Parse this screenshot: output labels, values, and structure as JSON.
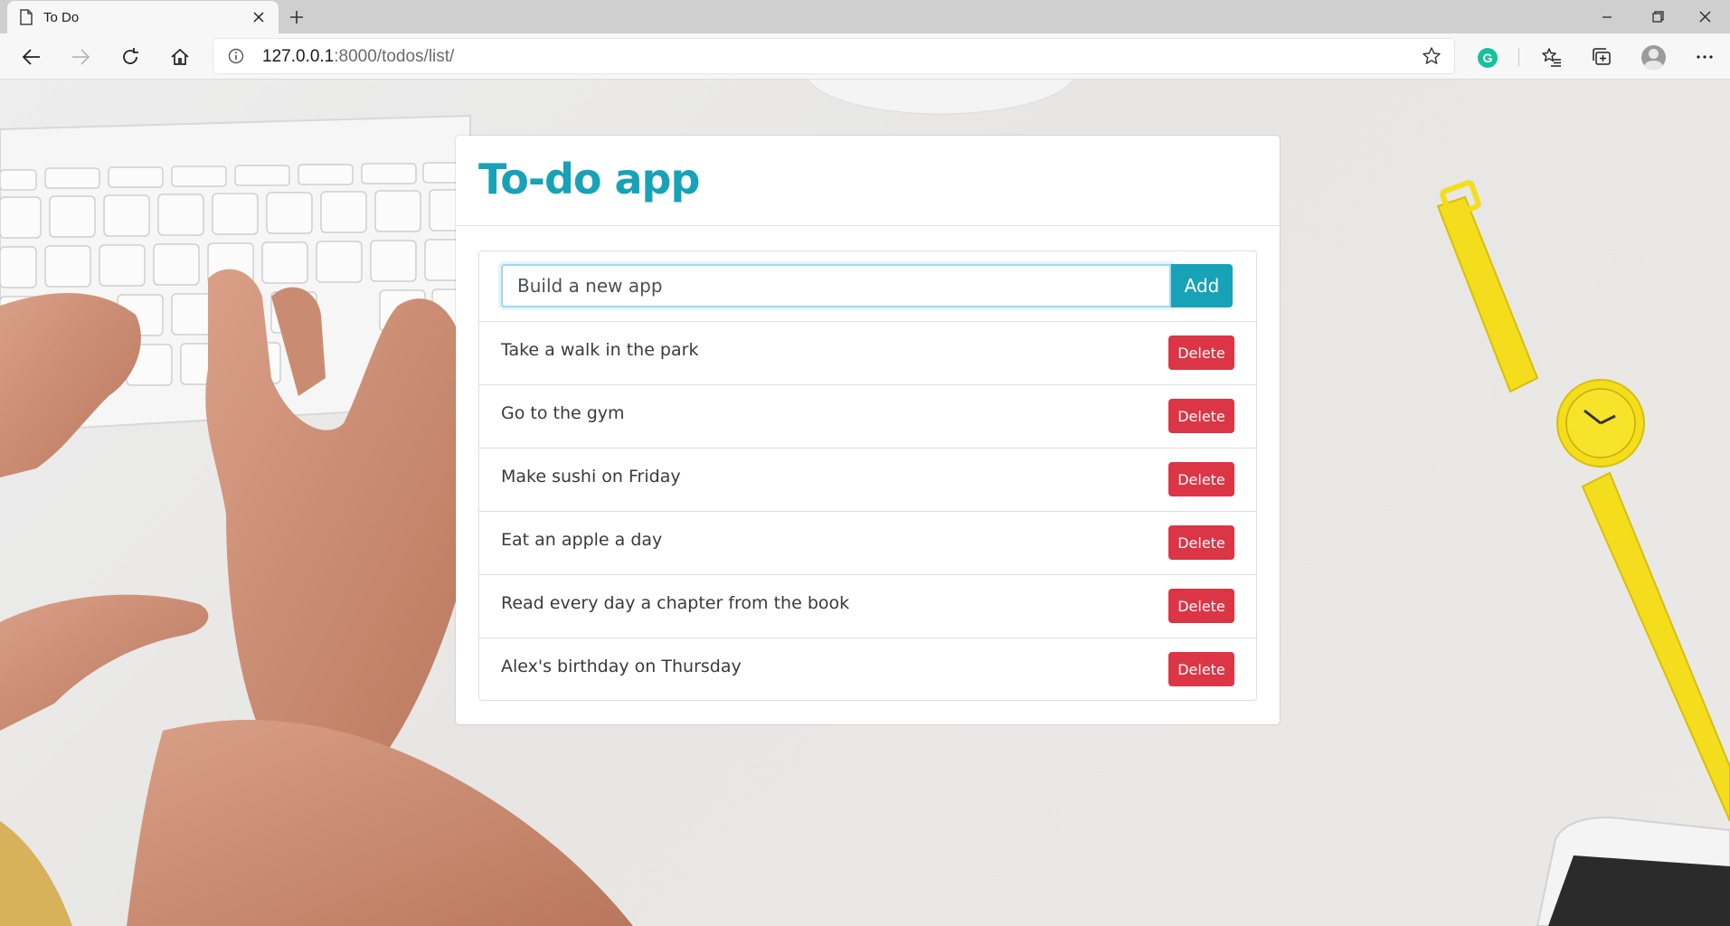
{
  "browser": {
    "tab_title": "To Do",
    "url_host": "127.0.0.1",
    "url_rest": ":8000/todos/list/"
  },
  "app": {
    "title": "To-do app",
    "input_value": "Build a new app",
    "add_label": "Add",
    "delete_label": "Delete",
    "accent_color": "#17a2b8",
    "danger_color": "#dc3545",
    "todos": [
      "Take a walk in the park",
      "Go to the gym",
      "Make sushi on Friday",
      "Eat an apple a day",
      "Read every day a chapter from the book",
      "Alex's birthday on Thursday"
    ]
  }
}
